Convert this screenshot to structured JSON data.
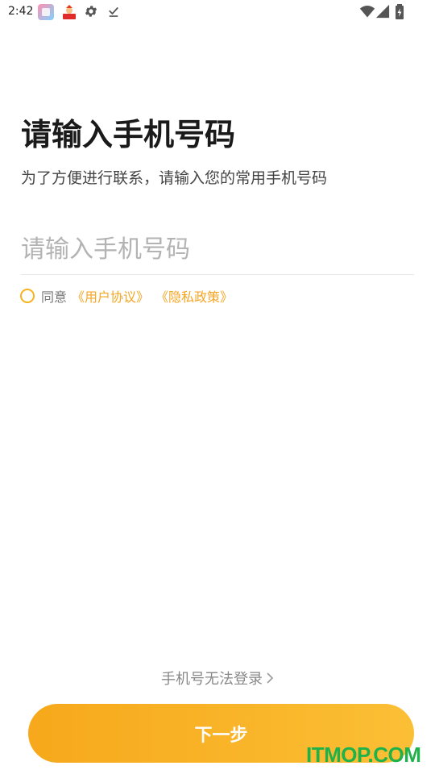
{
  "status_bar": {
    "time": "2:42",
    "icons": [
      "app-icon",
      "app-icon",
      "gear-icon",
      "download-done-icon",
      "wifi-icon",
      "signal-icon",
      "battery-charging-icon"
    ]
  },
  "title": "请输入手机号码",
  "subtitle": "为了方便进行联系，请输入您的常用手机号码",
  "phone_input": {
    "placeholder": "请输入手机号码",
    "value": ""
  },
  "agreement": {
    "agree_label": "同意",
    "user_agreement": "《用户协议》",
    "privacy_policy": "《隐私政策》",
    "checked": false
  },
  "no_login_link": "手机号无法登录",
  "next_button": "下一步",
  "watermark": "ITMOP.COM",
  "colors": {
    "accent": "#f7b21e",
    "link": "#f5a623",
    "watermark": "#20b24a"
  }
}
